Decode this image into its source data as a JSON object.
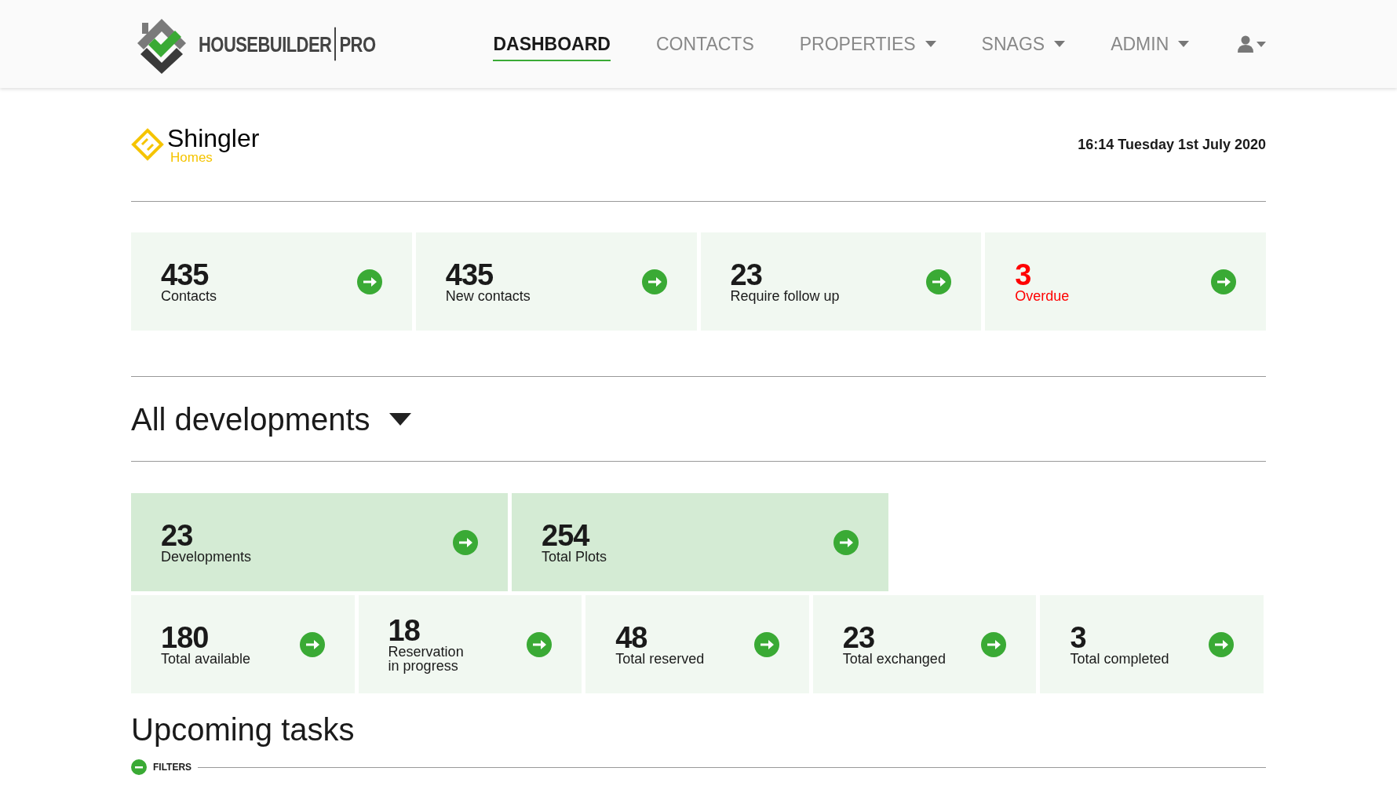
{
  "brand": {
    "name": "HOUSEBUILDER",
    "suffix": "PRO"
  },
  "nav": [
    {
      "label": "DASHBOARD",
      "selected": true,
      "dropdown": false
    },
    {
      "label": "CONTACTS",
      "selected": false,
      "dropdown": false
    },
    {
      "label": "PROPERTIES",
      "selected": false,
      "dropdown": true
    },
    {
      "label": "SNAGS",
      "selected": false,
      "dropdown": true
    },
    {
      "label": "ADMIN",
      "selected": false,
      "dropdown": true
    }
  ],
  "company": {
    "name": "Shingler",
    "subtitle": "Homes"
  },
  "datetime": "16:14 Tuesday 1st July 2020",
  "contact_stats": [
    {
      "value": "435",
      "label": "Contacts",
      "kind": "normal"
    },
    {
      "value": "435",
      "label": "New contacts",
      "kind": "normal"
    },
    {
      "value": "23",
      "label": "Require follow up",
      "kind": "normal"
    },
    {
      "value": "3",
      "label": "Overdue",
      "kind": "alert"
    }
  ],
  "development_selector": "All developments",
  "development_stats": [
    {
      "value": "23",
      "label": "Developments"
    },
    {
      "value": "254",
      "label": "Total Plots"
    }
  ],
  "plot_stats": [
    {
      "value": "180",
      "label": "Total available"
    },
    {
      "value": "18",
      "label": "Reservation\nin progress"
    },
    {
      "value": "48",
      "label": "Total reserved"
    },
    {
      "value": "23",
      "label": "Total exchanged"
    },
    {
      "value": "3",
      "label": "Total completed"
    }
  ],
  "tasks": {
    "title": "Upcoming tasks",
    "filters_label": "FILTERS"
  }
}
